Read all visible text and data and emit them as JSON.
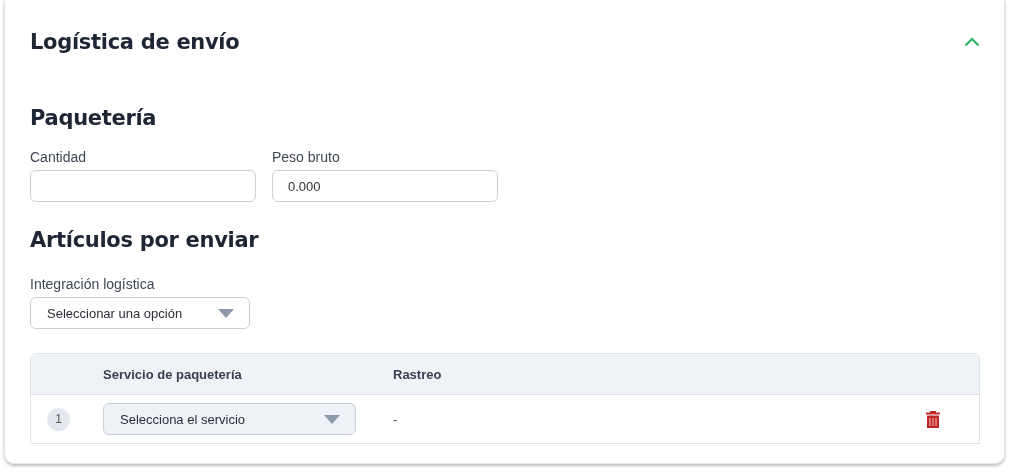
{
  "panel": {
    "title": "Logística de envío",
    "expanded": true
  },
  "package_section": {
    "heading": "Paquetería",
    "fields": [
      {
        "label": "Cantidad"
      },
      {
        "label": "Peso bruto",
        "value": "0.000"
      }
    ]
  },
  "items_section": {
    "heading": "Artículos por enviar",
    "integration": {
      "label": "Integración logística",
      "value": "Seleccionar una opción"
    },
    "table": {
      "columns": [
        "Servicio de paquetería",
        "Rastreo"
      ],
      "rows": [
        {
          "number": "1",
          "service": "Selecciona el servicio",
          "tracking": "-"
        }
      ]
    }
  }
}
